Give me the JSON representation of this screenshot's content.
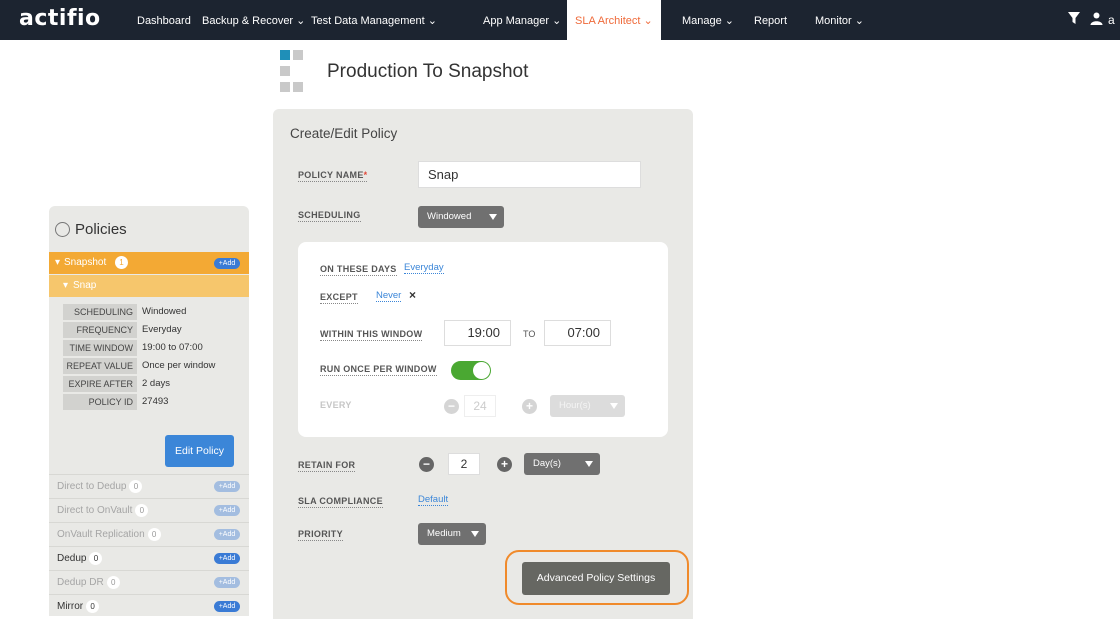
{
  "app": {
    "logo": "actifio"
  },
  "nav": {
    "items": [
      "Dashboard",
      "Backup & Recover ⌄",
      "Test Data Management ⌄",
      "App Manager ⌄",
      "SLA Architect ⌄",
      "Manage ⌄",
      "Report",
      "Monitor ⌄"
    ],
    "active": "SLA Architect",
    "user_initial": "a"
  },
  "page": {
    "title": "Production To Snapshot"
  },
  "sidebar": {
    "title": "Policies",
    "snapshot": {
      "label": "Snapshot",
      "count": "1",
      "add": "+Add"
    },
    "snap": {
      "label": "Snap"
    },
    "details": [
      {
        "k": "SCHEDULING",
        "v": "Windowed"
      },
      {
        "k": "FREQUENCY",
        "v": "Everyday"
      },
      {
        "k": "TIME WINDOW",
        "v": "19:00 to 07:00"
      },
      {
        "k": "REPEAT VALUE",
        "v": "Once per window"
      },
      {
        "k": "EXPIRE AFTER",
        "v": "2 days"
      },
      {
        "k": "POLICY ID",
        "v": "27493"
      }
    ],
    "edit_label": "Edit Policy",
    "rows": [
      {
        "label": "Direct to Dedup",
        "count": "0",
        "add": "+Add"
      },
      {
        "label": "Direct to OnVault",
        "count": "0",
        "add": "+Add"
      },
      {
        "label": "OnVault Replication",
        "count": "0",
        "add": "+Add"
      },
      {
        "label": "Dedup",
        "count": "0",
        "add": "+Add"
      },
      {
        "label": "Dedup DR",
        "count": "0",
        "add": "+Add"
      },
      {
        "label": "Mirror",
        "count": "0",
        "add": "+Add"
      }
    ]
  },
  "form": {
    "panel_title": "Create/Edit Policy",
    "policy_name_label": "POLICY NAME",
    "policy_name_required": "*",
    "policy_name_value": "Snap",
    "scheduling_label": "SCHEDULING",
    "scheduling_value": "Windowed",
    "on_days_label": "ON THESE DAYS",
    "on_days_value": "Everyday",
    "except_label": "EXCEPT",
    "except_value": "Never",
    "except_clear": "×",
    "window_label": "WITHIN THIS WINDOW",
    "window_start": "19:00",
    "window_to": "TO",
    "window_end": "07:00",
    "run_once_label": "RUN ONCE PER WINDOW",
    "run_once_on": true,
    "every_label": "EVERY",
    "every_value": "24",
    "every_unit": "Hour(s)",
    "retain_label": "RETAIN FOR",
    "retain_value": "2",
    "retain_unit": "Day(s)",
    "sla_label": "SLA COMPLIANCE",
    "sla_value": "Default",
    "priority_label": "PRIORITY",
    "priority_value": "Medium",
    "advanced_label": "Advanced Policy Settings"
  },
  "colors": {
    "nav_bg": "#1c2430",
    "active_nav": "#ef6a3a",
    "snapshot_orange": "#f3a934",
    "highlight": "#f08a2b",
    "toggle_on": "#4aa832"
  }
}
